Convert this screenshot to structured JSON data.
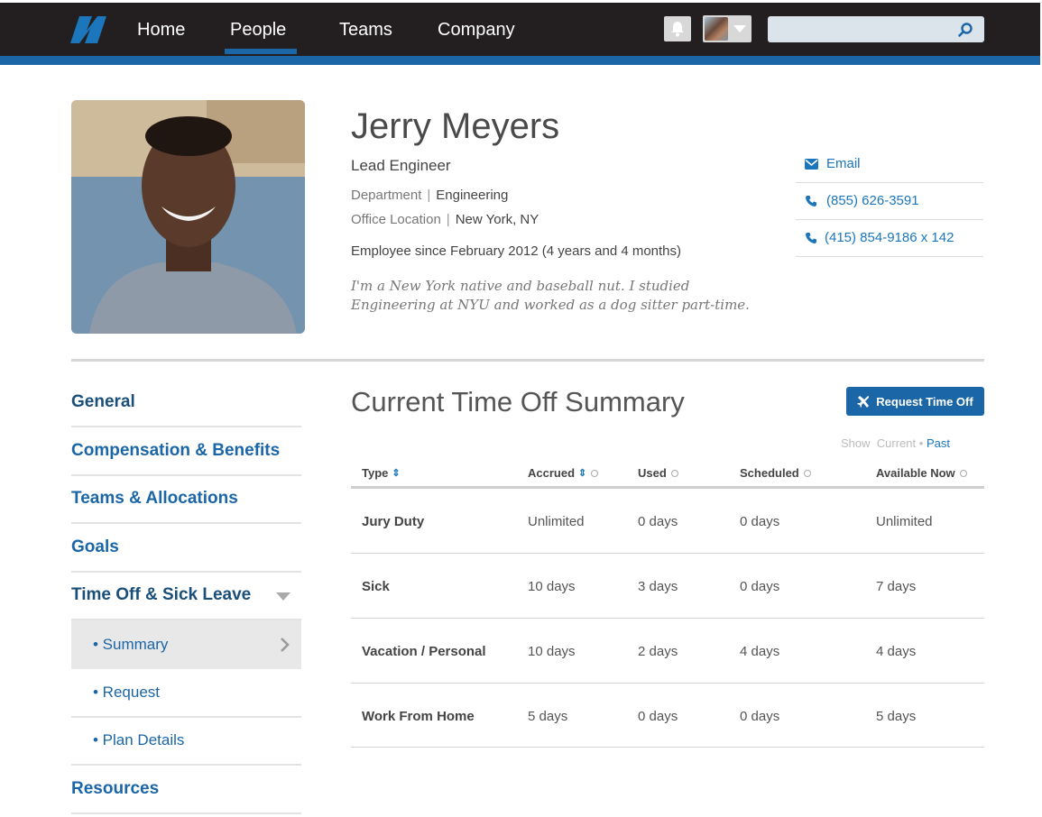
{
  "nav": {
    "items": [
      {
        "label": "Home"
      },
      {
        "label": "People",
        "active": true
      },
      {
        "label": "Teams"
      },
      {
        "label": "Company"
      }
    ],
    "search": {
      "value": "",
      "placeholder": ""
    },
    "colors": {
      "bar": "#231f20",
      "accent": "#1b66a7"
    }
  },
  "profile": {
    "name": "Jerry Meyers",
    "title": "Lead Engineer",
    "department_label": "Department",
    "department": "Engineering",
    "office_label": "Office Location",
    "office": "New York, NY",
    "since": "Employee since February 2012 (4 years and 4 months)",
    "bio": "I'm a New York native and baseball nut. I studied Engineering at NYU and worked as a dog sitter part-time.",
    "contacts": [
      {
        "icon": "envelope-icon",
        "label": "Email"
      },
      {
        "icon": "phone-icon",
        "label": "(855) 626-3591"
      },
      {
        "icon": "phone-icon",
        "label": "(415) 854-9186 x 142"
      }
    ]
  },
  "sidebar": {
    "items": [
      {
        "label": "General"
      },
      {
        "label": "Compensation & Benefits"
      },
      {
        "label": "Teams & Allocations"
      },
      {
        "label": "Goals"
      },
      {
        "label": "Time Off & Sick Leave",
        "expanded": true
      }
    ],
    "subitems": [
      {
        "label": "• Summary",
        "active": true
      },
      {
        "label": "• Request"
      },
      {
        "label": "• Plan Details"
      }
    ],
    "last": {
      "label": "Resources"
    }
  },
  "timeoff": {
    "title": "Current Time Off Summary",
    "request_button": "Request Time Off",
    "filter": {
      "show": "Show",
      "current": "Current",
      "dot": "•",
      "past": "Past",
      "selected": "Past"
    },
    "columns": [
      "Type",
      "Accrued",
      "Used",
      "Scheduled",
      "Available Now"
    ],
    "rows": [
      [
        "Jury Duty",
        "Unlimited",
        "0 days",
        "0 days",
        "Unlimited"
      ],
      [
        "Sick",
        "10 days",
        "3 days",
        "0 days",
        "7 days"
      ],
      [
        "Vacation / Personal",
        "10 days",
        "2 days",
        "4 days",
        "4 days"
      ],
      [
        "Work From Home",
        "5 days",
        "0 days",
        "0 days",
        "5 days"
      ]
    ]
  }
}
